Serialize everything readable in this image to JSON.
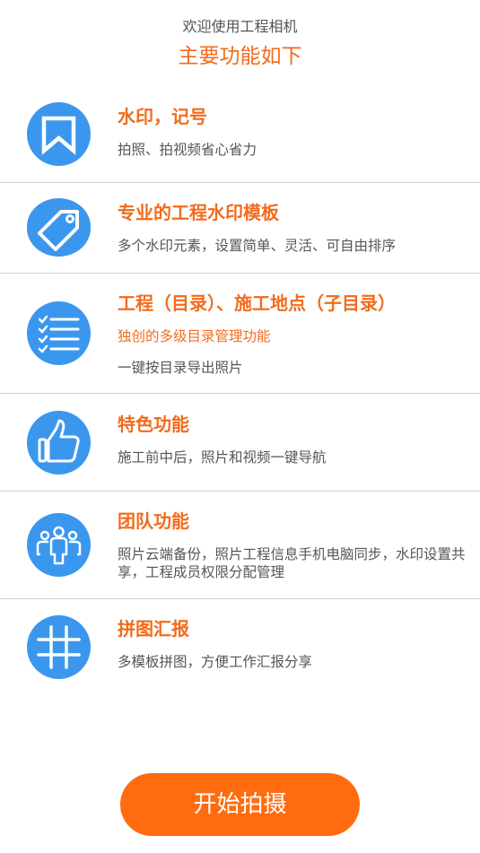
{
  "header": {
    "welcome": "欢迎使用工程相机",
    "subtitle": "主要功能如下"
  },
  "features": [
    {
      "title": "水印，记号",
      "desc": "拍照、拍视频省心省力",
      "icon": "bookmark-icon"
    },
    {
      "title": "专业的工程水印模板",
      "desc": "多个水印元素，设置简单、灵活、可自由排序",
      "icon": "tag-icon"
    },
    {
      "title": "工程（目录）、施工地点（子目录）",
      "accent": "独创的多级目录管理功能",
      "desc": "一键按目录导出照片",
      "icon": "checklist-icon"
    },
    {
      "title": "特色功能",
      "desc": "施工前中后，照片和视频一键导航",
      "icon": "thumbs-up-icon"
    },
    {
      "title": "团队功能",
      "desc": "照片云端备份，照片工程信息手机电脑同步，水印设置共享，工程成员权限分配管理",
      "icon": "team-icon"
    },
    {
      "title": "拼图汇报",
      "desc": "多模板拼图，方便工作汇报分享",
      "icon": "grid-icon"
    }
  ],
  "start_button": {
    "label": "开始拍摄"
  },
  "colors": {
    "accent": "#f26b1d",
    "button": "#ff6c0f",
    "icon_bg": "#3b97ee",
    "text": "#555555",
    "divider": "#d2d2d2"
  }
}
